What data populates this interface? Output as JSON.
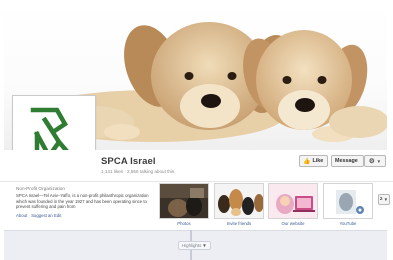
{
  "page": {
    "name": "SPCA Israel",
    "stats": "1,141 likes · 2,556 talking about this"
  },
  "actions": {
    "like_label": "Like",
    "message_label": "Message",
    "more_label": "2"
  },
  "about": {
    "category": "Non-Profit Organization",
    "description": "SPCA Israel—Tel Aviv–Yaffo, is a non-profit philanthropic organization which was founded in the year 1927 and has been operating since to prevent suffering and pain from",
    "about_link": "About",
    "suggest_link": "Suggest an Edit"
  },
  "apps": [
    {
      "label": "Photos"
    },
    {
      "label": "Invite friends"
    },
    {
      "label": "Our website"
    },
    {
      "label": "YouTube"
    }
  ],
  "timeline": {
    "highlights_label": "Highlights"
  },
  "icons": {
    "like": "thumbs-up-icon",
    "settings": "gear-icon",
    "dropdown": "caret-down-icon"
  },
  "colors": {
    "link": "#3b5998",
    "logo_green": "#2e7d32"
  }
}
